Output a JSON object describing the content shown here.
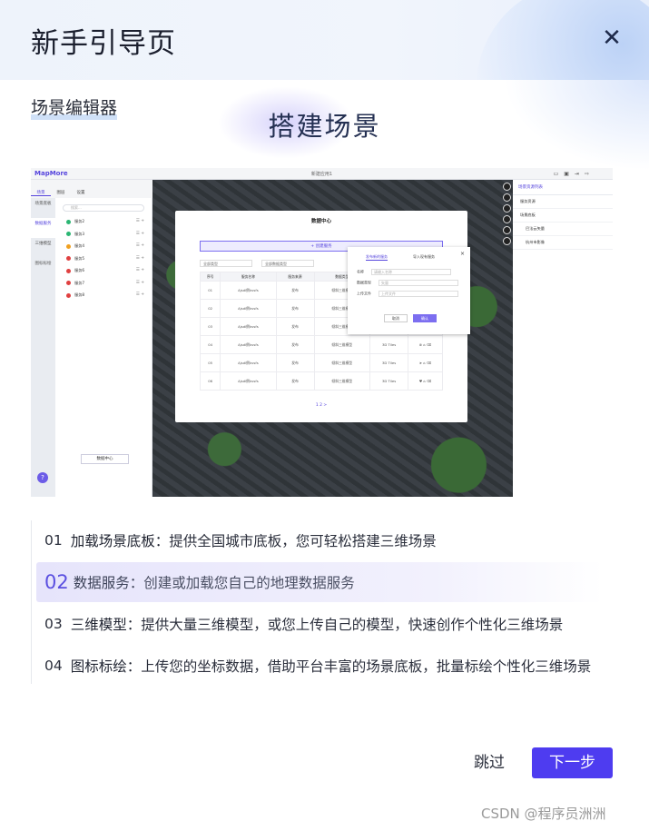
{
  "header": {
    "title": "新手引导页",
    "close_icon": "close-icon"
  },
  "section_label": "场景编辑器",
  "headline": "搭建场景",
  "screenshot": {
    "logo": "MapMore",
    "page_title": "新建应用1",
    "left_tabs": [
      "场景",
      "图层",
      "设置"
    ],
    "nav_items": [
      "场景底板",
      "数据服务",
      "三维模型",
      "图标标绘"
    ],
    "search_placeholder": "搜索...",
    "services": [
      "服务2",
      "服务3",
      "服务4",
      "服务5",
      "服务6",
      "服务7",
      "服务8"
    ],
    "data_center_button": "数据中心",
    "help": "?",
    "right_panel": {
      "title": "场景资源列表",
      "rows": [
        "服务资源",
        "场景底板",
        "巴法云矢量",
        "杭州市影像"
      ]
    },
    "data_center": {
      "title": "数据中心",
      "create_label": "+ 创建服务",
      "filters": [
        "全部类型",
        "全部数据类型"
      ],
      "columns": [
        "序号",
        "服务名称",
        "服务来源",
        "数据类型",
        "服务格式"
      ],
      "rows": [
        [
          "01",
          "Ajsdl倒kvsfs",
          "发布",
          "倾斜三维模型",
          "3D Tiles"
        ],
        [
          "02",
          "Ajsdl倒kvsfs",
          "发布",
          "倾斜三维模型",
          "3D Tiles"
        ],
        [
          "03",
          "Ajsdl倒kvsfs",
          "发布",
          "倾斜三维模型",
          "3D Tiles"
        ],
        [
          "04",
          "Ajsdl倒kvsfs",
          "发布",
          "倾斜三维模型",
          "3D Tiles"
        ],
        [
          "05",
          "Ajsdl倒kvsfs",
          "发布",
          "倾斜三维模型",
          "3D Tiles"
        ],
        [
          "06",
          "Ajsdl倒kvsfs",
          "发布",
          "倾斜三维模型",
          "3D Tiles"
        ]
      ],
      "pager": "1 2 >"
    },
    "publish_dialog": {
      "tabs": [
        "发布新的服务",
        "导入现有服务"
      ],
      "fields": [
        {
          "label": "名称",
          "placeholder": "请输入名称"
        },
        {
          "label": "数据类型",
          "placeholder": "矢量"
        },
        {
          "label": "上传文件",
          "placeholder": "上传文件"
        }
      ],
      "cancel": "取消",
      "confirm": "确认"
    }
  },
  "steps": [
    {
      "num": "01",
      "name": "加载场景底板：",
      "desc": "提供全国城市底板，您可轻松搭建三维场景"
    },
    {
      "num": "02",
      "name": "数据服务：",
      "desc": "创建或加载您自己的地理数据服务"
    },
    {
      "num": "03",
      "name": "三维模型：",
      "desc": "提供大量三维模型，或您上传自己的模型，快速创作个性化三维场景"
    },
    {
      "num": "04",
      "name": "图标标绘：",
      "desc": "上传您的坐标数据，借助平台丰富的场景底板，批量标绘个性化三维场景"
    }
  ],
  "active_step": "02",
  "buttons": {
    "skip": "跳过",
    "next": "下一步"
  },
  "watermark": "CSDN @程序员洲洲",
  "colors": {
    "accent": "#4e3cf0",
    "active_step_bg": "#e6e4fb"
  }
}
